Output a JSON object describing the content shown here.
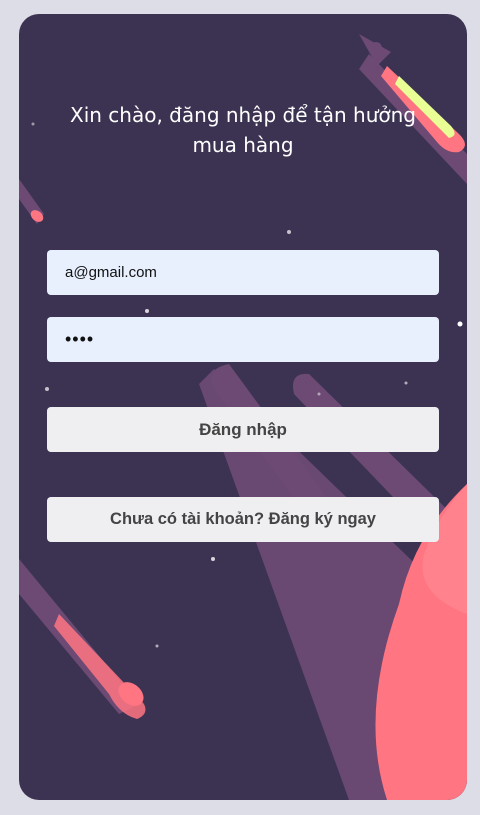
{
  "header": {
    "title": "Xin chào, đăng nhập để tận hưởng mua hàng"
  },
  "form": {
    "email_value": "a@gmail.com",
    "password_value": "1234",
    "login_label": "Đăng nhập",
    "register_label": "Chưa có tài khoản? Đăng ký ngay"
  },
  "colors": {
    "card_background": "#3c3353",
    "page_background": "#dcdde6",
    "planet": "#ff7582",
    "shape": "#6c4a74",
    "input_background": "#e8f0fe",
    "button_background": "#efeff2"
  }
}
